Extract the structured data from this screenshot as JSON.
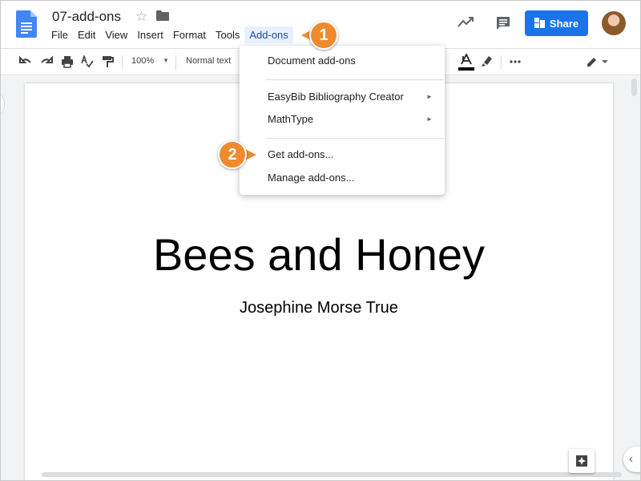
{
  "app": {
    "doc_title": "07-add-ons",
    "share_label": "Share"
  },
  "menubar": [
    "File",
    "Edit",
    "View",
    "Insert",
    "Format",
    "Tools",
    "Add-ons"
  ],
  "active_menu": "Add-ons",
  "toolbar": {
    "zoom": "100%",
    "style": "Normal text"
  },
  "addons_menu": {
    "document_addons": "Document add-ons",
    "easybib": "EasyBib Bibliography Creator",
    "mathtype": "MathType",
    "get_addons": "Get add-ons...",
    "manage_addons": "Manage add-ons..."
  },
  "document": {
    "heading": "Bees and Honey",
    "author": "Josephine Morse True"
  },
  "callouts": {
    "step1": "1",
    "step2": "2"
  },
  "colors": {
    "accent": "#1a73e8",
    "callout": "#f08a2c",
    "active_menu_bg": "#e8f0fe"
  },
  "icons": [
    "docs-logo-icon",
    "star-icon",
    "folder-icon",
    "trending-icon",
    "comment-icon",
    "lock-icon",
    "undo-icon",
    "redo-icon",
    "print-icon",
    "spellcheck-icon",
    "paint-format-icon",
    "underline-icon",
    "text-color-icon",
    "highlight-icon",
    "more-icon",
    "edit-mode-icon",
    "explore-icon",
    "chevron-left-icon"
  ]
}
